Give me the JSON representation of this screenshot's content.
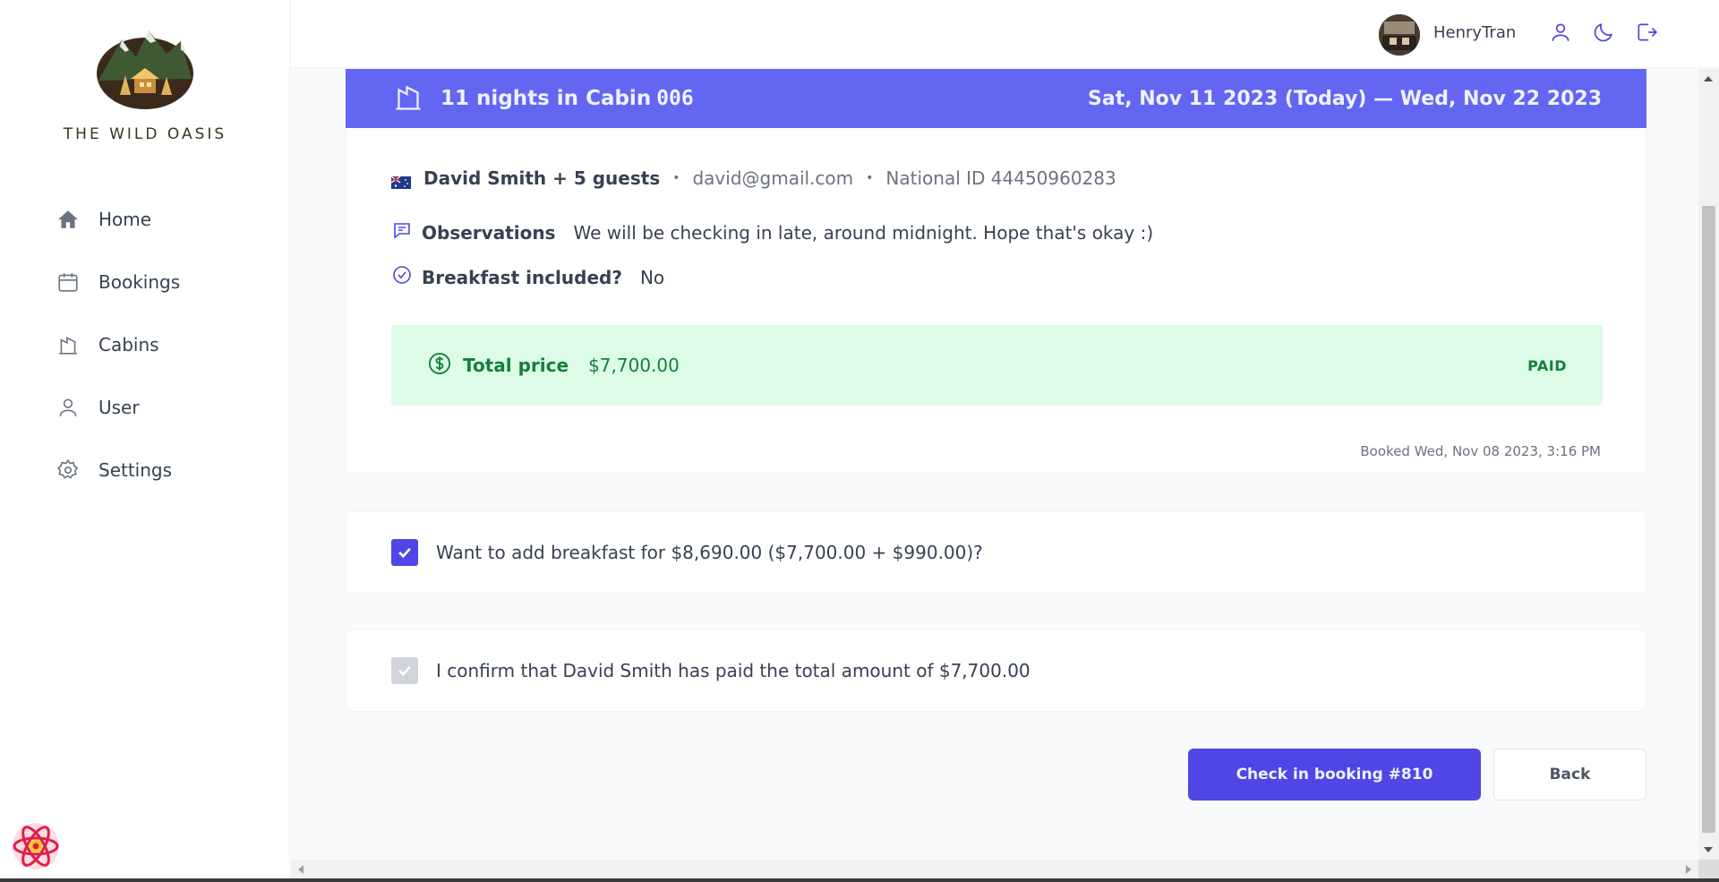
{
  "brand": {
    "name": "THE WILD OASIS"
  },
  "nav": {
    "items": [
      {
        "label": "Home",
        "icon": "home-icon"
      },
      {
        "label": "Bookings",
        "icon": "calendar-icon"
      },
      {
        "label": "Cabins",
        "icon": "building-icon"
      },
      {
        "label": "User",
        "icon": "user-icon"
      },
      {
        "label": "Settings",
        "icon": "gear-icon"
      }
    ]
  },
  "header": {
    "username": "HenryTran",
    "icons": [
      "user-icon",
      "moon-icon",
      "logout-icon"
    ]
  },
  "booking": {
    "nights_label": "11 nights in Cabin",
    "cabin": "006",
    "dates": "Sat, Nov 11 2023 (Today) — Wed, Nov 22 2023",
    "guest": "David Smith + 5 guests",
    "email": "david@gmail.com",
    "national_id": "National ID 44450960283",
    "observations_label": "Observations",
    "observations": "We will be checking in late, around midnight. Hope that's okay :)",
    "breakfast_label": "Breakfast included?",
    "breakfast_value": "No",
    "total_label": "Total price",
    "total_value": "$7,700.00",
    "payment_status": "PAID",
    "booked_at": "Booked Wed, Nov 08 2023, 3:16 PM"
  },
  "checkin": {
    "breakfast_question": "Want to add breakfast for $8,690.00 ($7,700.00 + $990.00)?",
    "breakfast_checked": true,
    "confirm_text": "I confirm that David Smith has paid the total amount of $7,700.00",
    "confirm_checked": true,
    "confirm_disabled": true
  },
  "actions": {
    "checkin_label": "Check in booking #810",
    "back_label": "Back"
  },
  "colors": {
    "accent": "#4f46e5",
    "header_band": "#6366f1",
    "paid_bg": "#dcfce7",
    "paid_text": "#15803d"
  }
}
